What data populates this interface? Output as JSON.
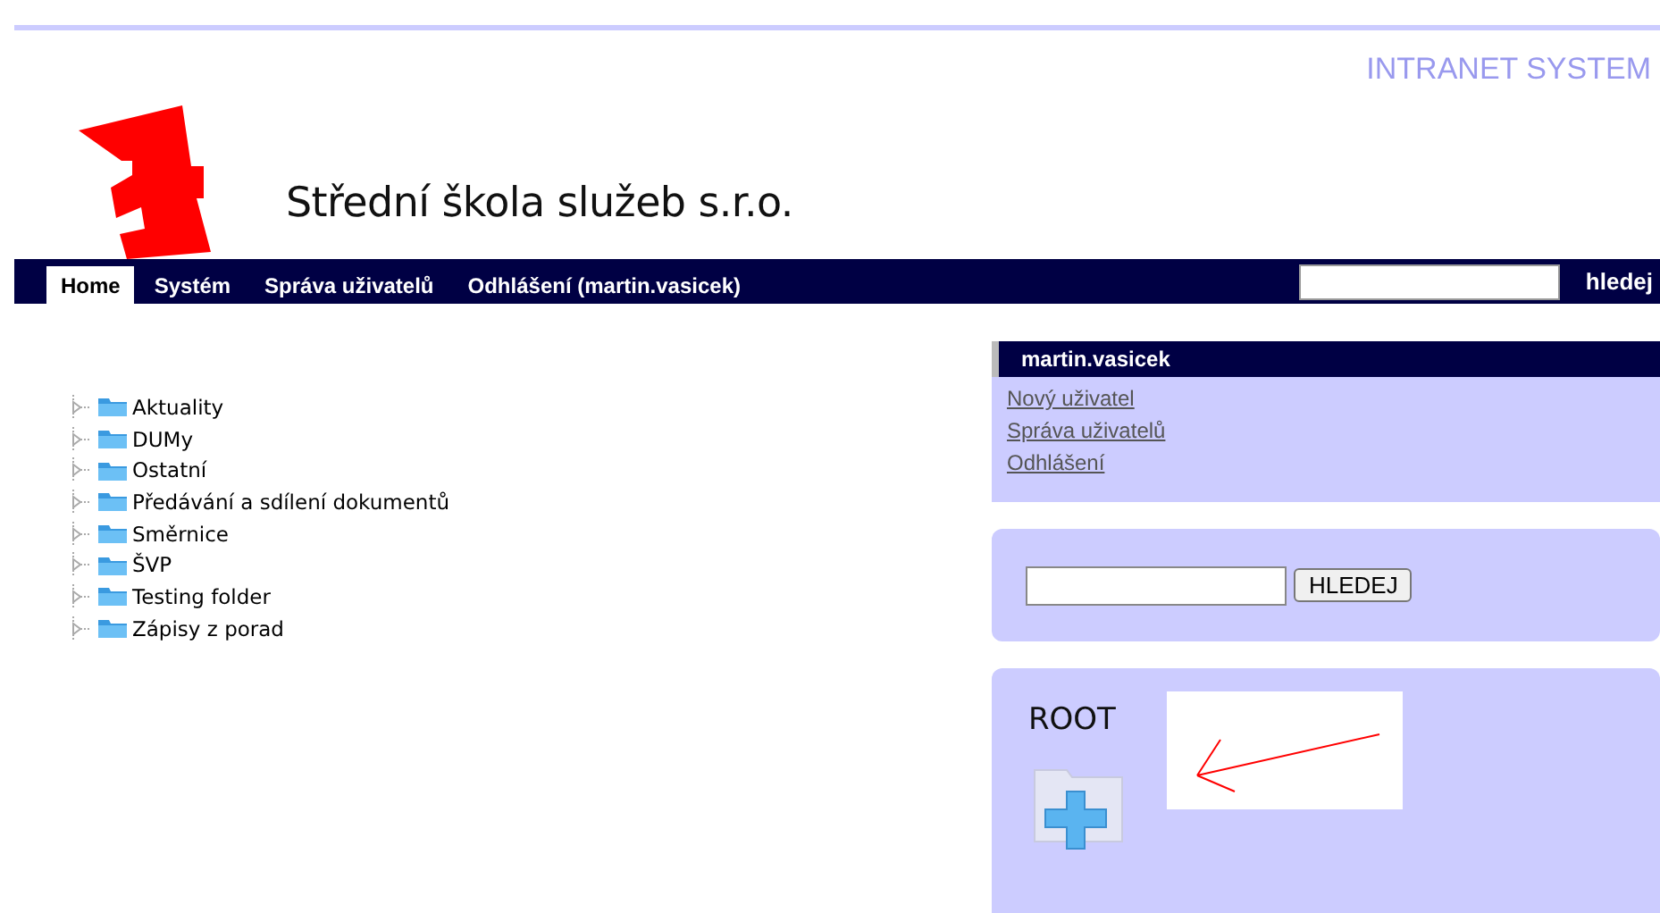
{
  "header": {
    "system_title": "INTRANET SYSTEM",
    "school_name": "Střední škola služeb s.r.o."
  },
  "nav": {
    "items": [
      {
        "label": "Home",
        "selected": true
      },
      {
        "label": "Systém",
        "selected": false
      },
      {
        "label": "Správa uživatelů",
        "selected": false
      },
      {
        "label": "Odhlášení (martin.vasicek)",
        "selected": false
      }
    ],
    "search_button": "hledej"
  },
  "tree": [
    {
      "label": "Aktuality"
    },
    {
      "label": "DUMy"
    },
    {
      "label": "Ostatní"
    },
    {
      "label": "Předávání a sdílení dokumentů"
    },
    {
      "label": "Směrnice"
    },
    {
      "label": "ŠVP"
    },
    {
      "label": "Testing folder"
    },
    {
      "label": "Zápisy z porad"
    }
  ],
  "user_panel": {
    "title": "martin.vasicek",
    "links": [
      "Nový uživatel",
      "Správa uživatelů",
      "Odhlášení"
    ]
  },
  "search_panel": {
    "button": "HLEDEJ"
  },
  "root_panel": {
    "title": "ROOT"
  }
}
